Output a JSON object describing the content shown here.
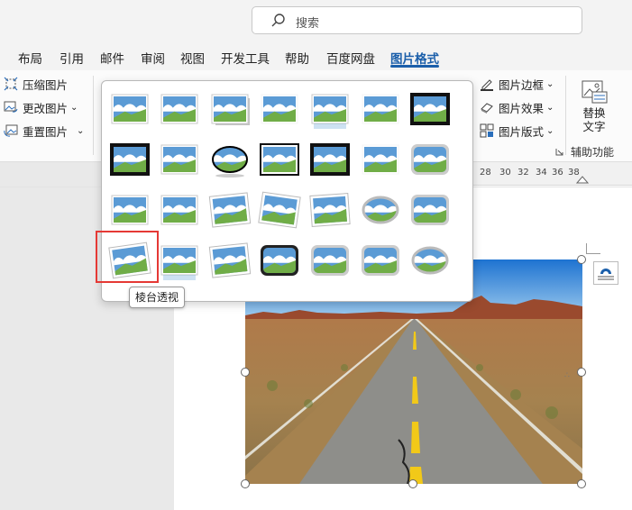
{
  "search": {
    "placeholder": "搜索"
  },
  "tabs": [
    {
      "label": "布局"
    },
    {
      "label": "引用"
    },
    {
      "label": "邮件"
    },
    {
      "label": "审阅"
    },
    {
      "label": "视图"
    },
    {
      "label": "开发工具"
    },
    {
      "label": "帮助"
    },
    {
      "label": "百度网盘"
    },
    {
      "label": "图片格式",
      "active": true
    }
  ],
  "ribbon": {
    "adjust": {
      "compress": "压缩图片",
      "change": "更改图片",
      "reset": "重置图片"
    },
    "styles": {
      "border": "图片边框",
      "effects": "图片效果",
      "layout": "图片版式"
    },
    "accessibility": {
      "alt_text_line1": "替换",
      "alt_text_line2": "文字",
      "group_label": "辅助功能"
    }
  },
  "ruler": {
    "ticks": [
      "28",
      "30",
      "32",
      "34",
      "36",
      "38"
    ]
  },
  "gallery": {
    "tooltip": "棱台透视",
    "selected_index": 21
  },
  "colors": {
    "accent": "#1b5faa",
    "highlight": "#e53935",
    "sky": "#5b9bd5",
    "grass": "#70ad47"
  },
  "icons": {
    "search": "search-icon",
    "compress": "compress-pictures-icon",
    "change": "change-picture-icon",
    "reset": "reset-picture-icon",
    "border": "picture-border-icon",
    "effects": "picture-effects-icon",
    "layout": "picture-layout-icon",
    "alt_text": "alt-text-icon",
    "launcher": "dialog-launcher-icon",
    "layout_options": "layout-options-icon"
  }
}
